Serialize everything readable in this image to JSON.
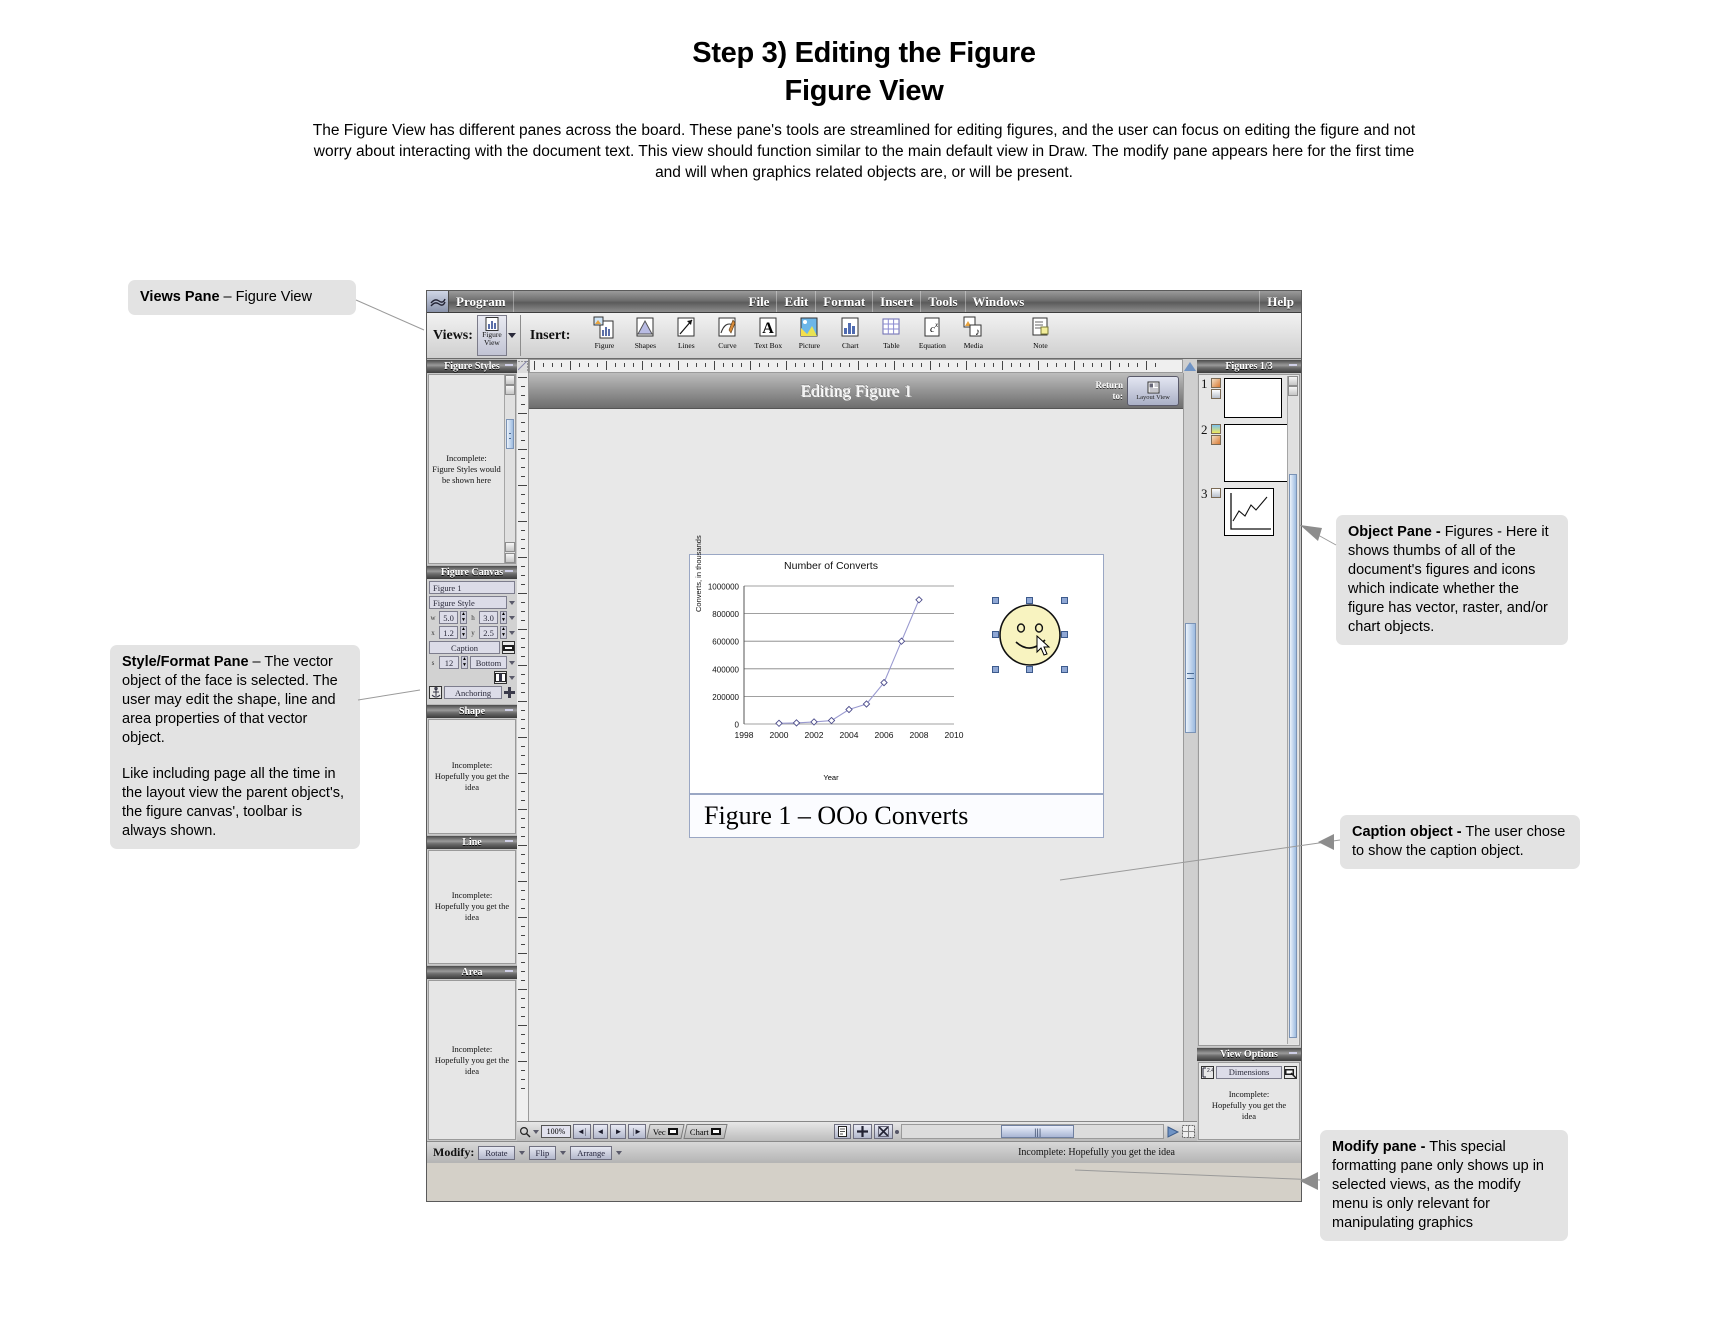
{
  "page": {
    "title_line1": "Step 3) Editing the Figure",
    "title_line2": "Figure View",
    "description": "The Figure View has different panes across the board.  These pane's tools are streamlined for editing figures, and the user can focus on editing the figure and not worry about interacting with the document text.  This view should function similar to the main default view in Draw.  The modify pane appears here for the first time and will when graphics related objects are, or will be present."
  },
  "menubar": {
    "program": "Program",
    "items": [
      "File",
      "Edit",
      "Format",
      "Insert",
      "Tools",
      "Windows"
    ],
    "help": "Help"
  },
  "toolbar": {
    "views_label": "Views:",
    "views_button": {
      "line1": "Figure",
      "line2": "View"
    },
    "insert_label": "Insert:",
    "tools": [
      {
        "name": "Figure",
        "icon": "figure-icon"
      },
      {
        "name": "Shapes",
        "icon": "shapes-icon"
      },
      {
        "name": "Lines",
        "icon": "lines-icon"
      },
      {
        "name": "Curve",
        "icon": "curve-icon"
      },
      {
        "name": "Text Box",
        "icon": "textbox-icon"
      },
      {
        "name": "Picture",
        "icon": "picture-icon"
      },
      {
        "name": "Chart",
        "icon": "chart-icon"
      },
      {
        "name": "Table",
        "icon": "table-icon"
      },
      {
        "name": "Equation",
        "icon": "equation-icon"
      },
      {
        "name": "Media",
        "icon": "media-icon"
      },
      {
        "name": "Note",
        "icon": "note-icon"
      }
    ]
  },
  "left_panes": {
    "figure_styles": {
      "title": "Figure Styles",
      "body": "Incomplete:\nFigure Styles would\nbe shown here"
    },
    "figure_canvas": {
      "title": "Figure Canvas",
      "name_value": "Figure 1",
      "style_value": "Figure Style",
      "width_label": "w",
      "width_value": "5.0",
      "height_label": "h",
      "height_value": "3.0",
      "x_label": "x",
      "x_value": "1.2",
      "y_label": "y",
      "y_value": "2.5",
      "caption_button": "Caption",
      "caption_size_label": "s",
      "caption_size_value": "12",
      "caption_position": "Bottom",
      "anchoring_button": "Anchoring"
    },
    "shape": {
      "title": "Shape",
      "body": "Incomplete:\nHopefully you get the\nidea"
    },
    "line": {
      "title": "Line",
      "body": "Incomplete:\nHopefully you get the\nidea"
    },
    "area": {
      "title": "Area",
      "body": "Incomplete:\nHopefully you get the\nidea"
    }
  },
  "document": {
    "figure_title": "Editing Figure 1",
    "return_to_label": "Return\nto:",
    "return_to_button": "Layout View",
    "caption_text": "Figure 1 – OOo Converts"
  },
  "chart_data": {
    "type": "line",
    "title": "Number of Converts",
    "xlabel": "Year",
    "ylabel": "Converts, in thousands",
    "x": [
      2000,
      2001,
      2002,
      2003,
      2004,
      2005,
      2006,
      2007,
      2008
    ],
    "values": [
      5000,
      8000,
      15000,
      25000,
      105000,
      145000,
      300000,
      600000,
      900000
    ],
    "xticks": [
      1998,
      2000,
      2002,
      2004,
      2006,
      2008,
      2010
    ],
    "yticks": [
      0,
      200000,
      400000,
      600000,
      800000,
      1000000
    ],
    "xlim": [
      1998,
      2010
    ],
    "ylim": [
      0,
      1000000
    ],
    "grid": true,
    "legend": "none",
    "marker": "diamond",
    "series_color": "#9a9ad0"
  },
  "right_panes": {
    "figures": {
      "title": "Figures 1/3",
      "items": [
        {
          "number": "1",
          "icons": [
            "vector-icon",
            "chart-icon"
          ]
        },
        {
          "number": "2",
          "icons": [
            "raster-icon",
            "vector-icon"
          ]
        },
        {
          "number": "3",
          "icons": [
            "chart-icon"
          ]
        }
      ]
    },
    "view_options": {
      "title": "View Options",
      "dimensions_button": "Dimensions",
      "body": "Incomplete:\nHopefully you get the\nidea"
    }
  },
  "statusbar": {
    "zoom_value": "100%",
    "nav_buttons": [
      "first",
      "previous",
      "next",
      "last"
    ],
    "tabs": [
      "Vec",
      "Chart"
    ]
  },
  "modify_pane": {
    "label": "Modify:",
    "buttons": [
      "Rotate",
      "Flip",
      "Arrange"
    ],
    "note": "Incomplete: Hopefully you get the idea"
  },
  "callouts": {
    "views_pane": {
      "bold": "Views Pane",
      "rest": " – Figure View"
    },
    "style_format_pane": {
      "bold": "Style/Format Pane",
      "rest": " – The vector object of the face is selected.  The user may edit the shape, line and area properties of that vector object.",
      "rest2": "Like including page all the time in the layout view the parent object's, the figure canvas', toolbar is always shown."
    },
    "object_pane": {
      "bold": "Object Pane -",
      "rest": " Figures - Here it shows thumbs of all of the document's figures and icons which indicate whether the figure has vector, raster, and/or chart objects."
    },
    "caption_object": {
      "bold": "Caption object -",
      "rest": " The user chose to show the caption object."
    },
    "modify_pane": {
      "bold": "Modify pane -",
      "rest": " This special formatting pane only shows up in selected views, as the modify menu is only relevant for manipulating graphics"
    }
  }
}
